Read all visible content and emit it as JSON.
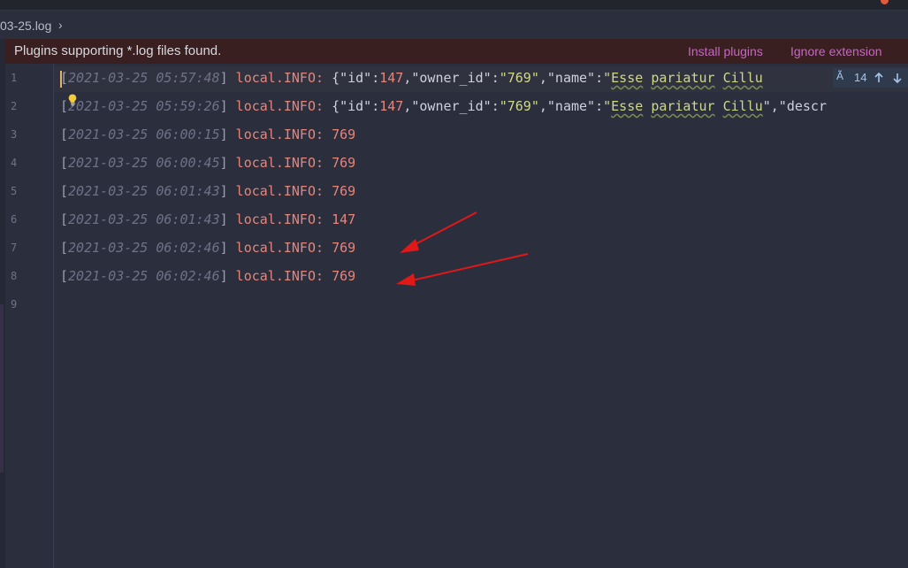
{
  "breadcrumb": {
    "file": "03-25.log",
    "chevron": "›"
  },
  "banner": {
    "message": "Plugins supporting *.log files found.",
    "install_label": "Install plugins",
    "ignore_label": "Ignore extension"
  },
  "find_widget": {
    "match_count": "14",
    "icon": "regex-icon"
  },
  "line_numbers": [
    "1",
    "2",
    "3",
    "4",
    "5",
    "6",
    "7",
    "8",
    "9"
  ],
  "lines": [
    {
      "bopen": "[",
      "ts": "2021-03-25 05:57:48",
      "bclose": "]",
      "level": " local.INFO: ",
      "j1": "{",
      "k1": "\"id\"",
      "c1": ":",
      "v1": "147",
      "s1": ",",
      "k2": "\"owner_id\"",
      "c2": ":",
      "v2": "\"769\"",
      "s2": ",",
      "k3": "\"name\"",
      "c3": ":",
      "q3": "\"",
      "w1": "Esse",
      "sp1": " ",
      "w2": "pariatur",
      "sp2": " ",
      "w3": "Cillu"
    },
    {
      "bopen": "[",
      "ts": "2021-03-25 05:59:26",
      "bclose": "]",
      "level": " local.INFO: ",
      "j1": "{",
      "k1": "\"id\"",
      "c1": ":",
      "v1": "147",
      "s1": ",",
      "k2": "\"owner_id\"",
      "c2": ":",
      "v2": "\"769\"",
      "s2": ",",
      "k3": "\"name\"",
      "c3": ":",
      "q3": "\"",
      "w1": "Esse",
      "sp1": " ",
      "w2": "pariatur",
      "sp2": " ",
      "w3": "Cillu",
      "tail": "\",\"descr"
    },
    {
      "bopen": "[",
      "ts": "2021-03-25 06:00:15",
      "bclose": "]",
      "level": " local.INFO: ",
      "value": "769"
    },
    {
      "bopen": "[",
      "ts": "2021-03-25 06:00:45",
      "bclose": "]",
      "level": " local.INFO: ",
      "value": "769"
    },
    {
      "bopen": "[",
      "ts": "2021-03-25 06:01:43",
      "bclose": "]",
      "level": " local.INFO: ",
      "value": "769"
    },
    {
      "bopen": "[",
      "ts": "2021-03-25 06:01:43",
      "bclose": "]",
      "level": " local.INFO: ",
      "value": "147"
    },
    {
      "bopen": "[",
      "ts": "2021-03-25 06:02:46",
      "bclose": "]",
      "level": " local.INFO: ",
      "value": "769"
    },
    {
      "bopen": "[",
      "ts": "2021-03-25 06:02:46",
      "bclose": "]",
      "level": " local.INFO: ",
      "value": "769"
    }
  ],
  "colors": {
    "background": "#2b2e3d",
    "banner": "#3a1f20",
    "link": "#c467c2",
    "annotation_arrow": "#e01818",
    "timestamp": "#6d7287",
    "level": "#e5867b",
    "json_string": "#cfd88a"
  },
  "icons": {
    "bulb": "lightbulb-icon",
    "up": "arrow-up-icon",
    "down": "arrow-down-icon"
  }
}
